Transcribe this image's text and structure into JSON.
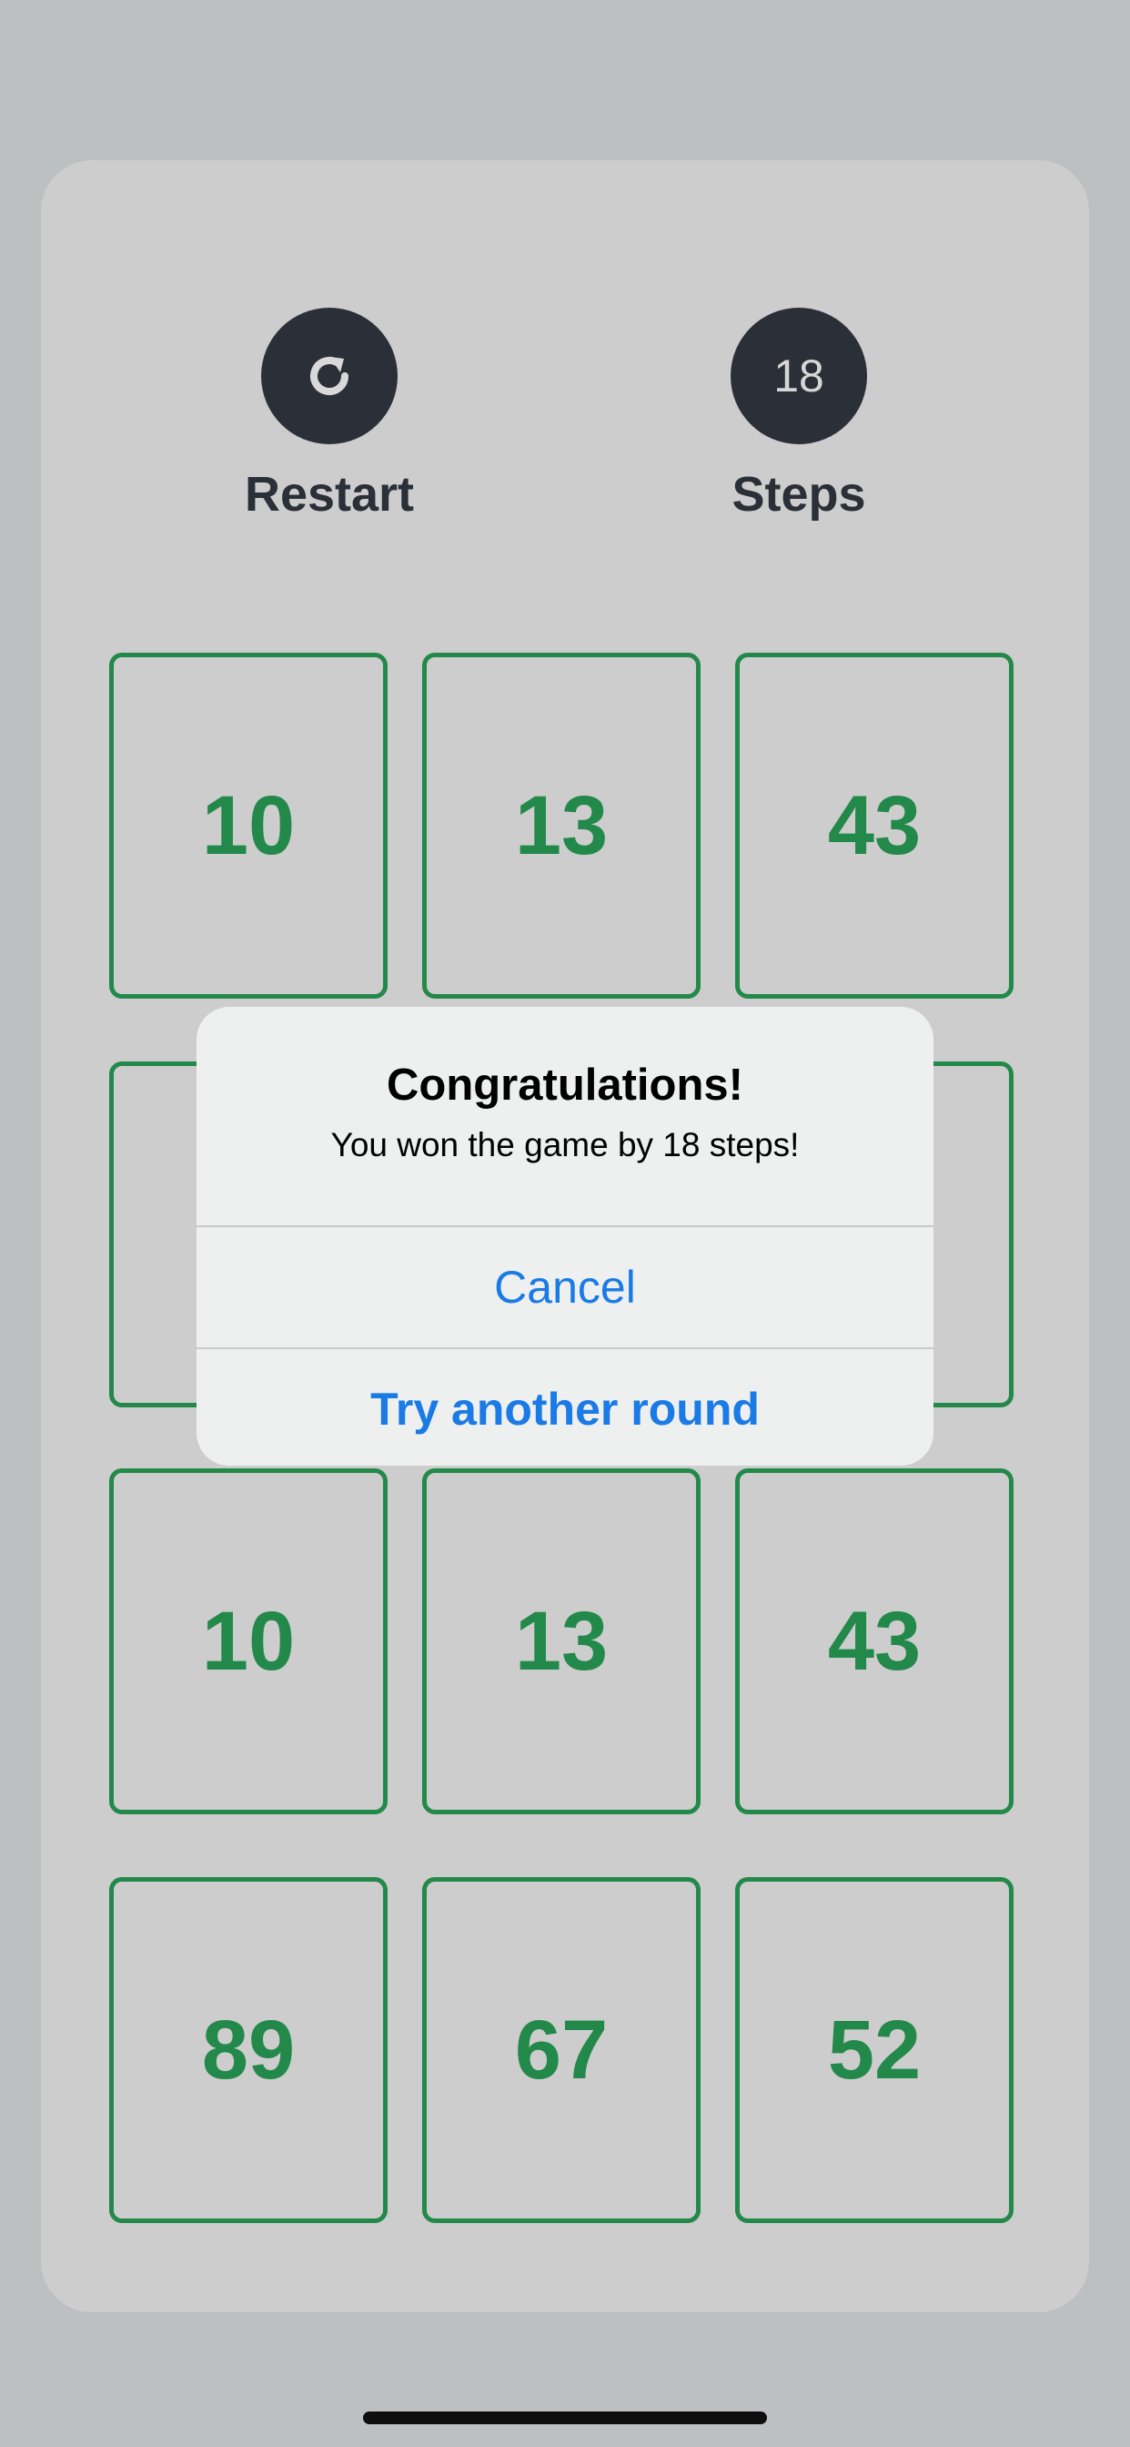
{
  "colors": {
    "background": "#bdc0c1",
    "board": "#cdcdcd",
    "control_circle": "#2b2f38",
    "tile_border": "#22894a",
    "tile_text": "#22894a",
    "alert_background": "#eef0ef",
    "alert_button_text": "#1a7ae6"
  },
  "controls": {
    "restart": {
      "icon": "restart-arrow-icon",
      "label": "Restart"
    },
    "steps": {
      "count": "18",
      "label": "Steps"
    }
  },
  "tiles": [
    [
      "10",
      "13",
      "43"
    ],
    [
      "",
      "",
      ""
    ],
    [
      "10",
      "13",
      "43"
    ],
    [
      "89",
      "67",
      "52"
    ]
  ],
  "alert": {
    "title": "Congratulations!",
    "message": "You won the game by 18 steps!",
    "cancel_label": "Cancel",
    "retry_label": "Try another round"
  }
}
